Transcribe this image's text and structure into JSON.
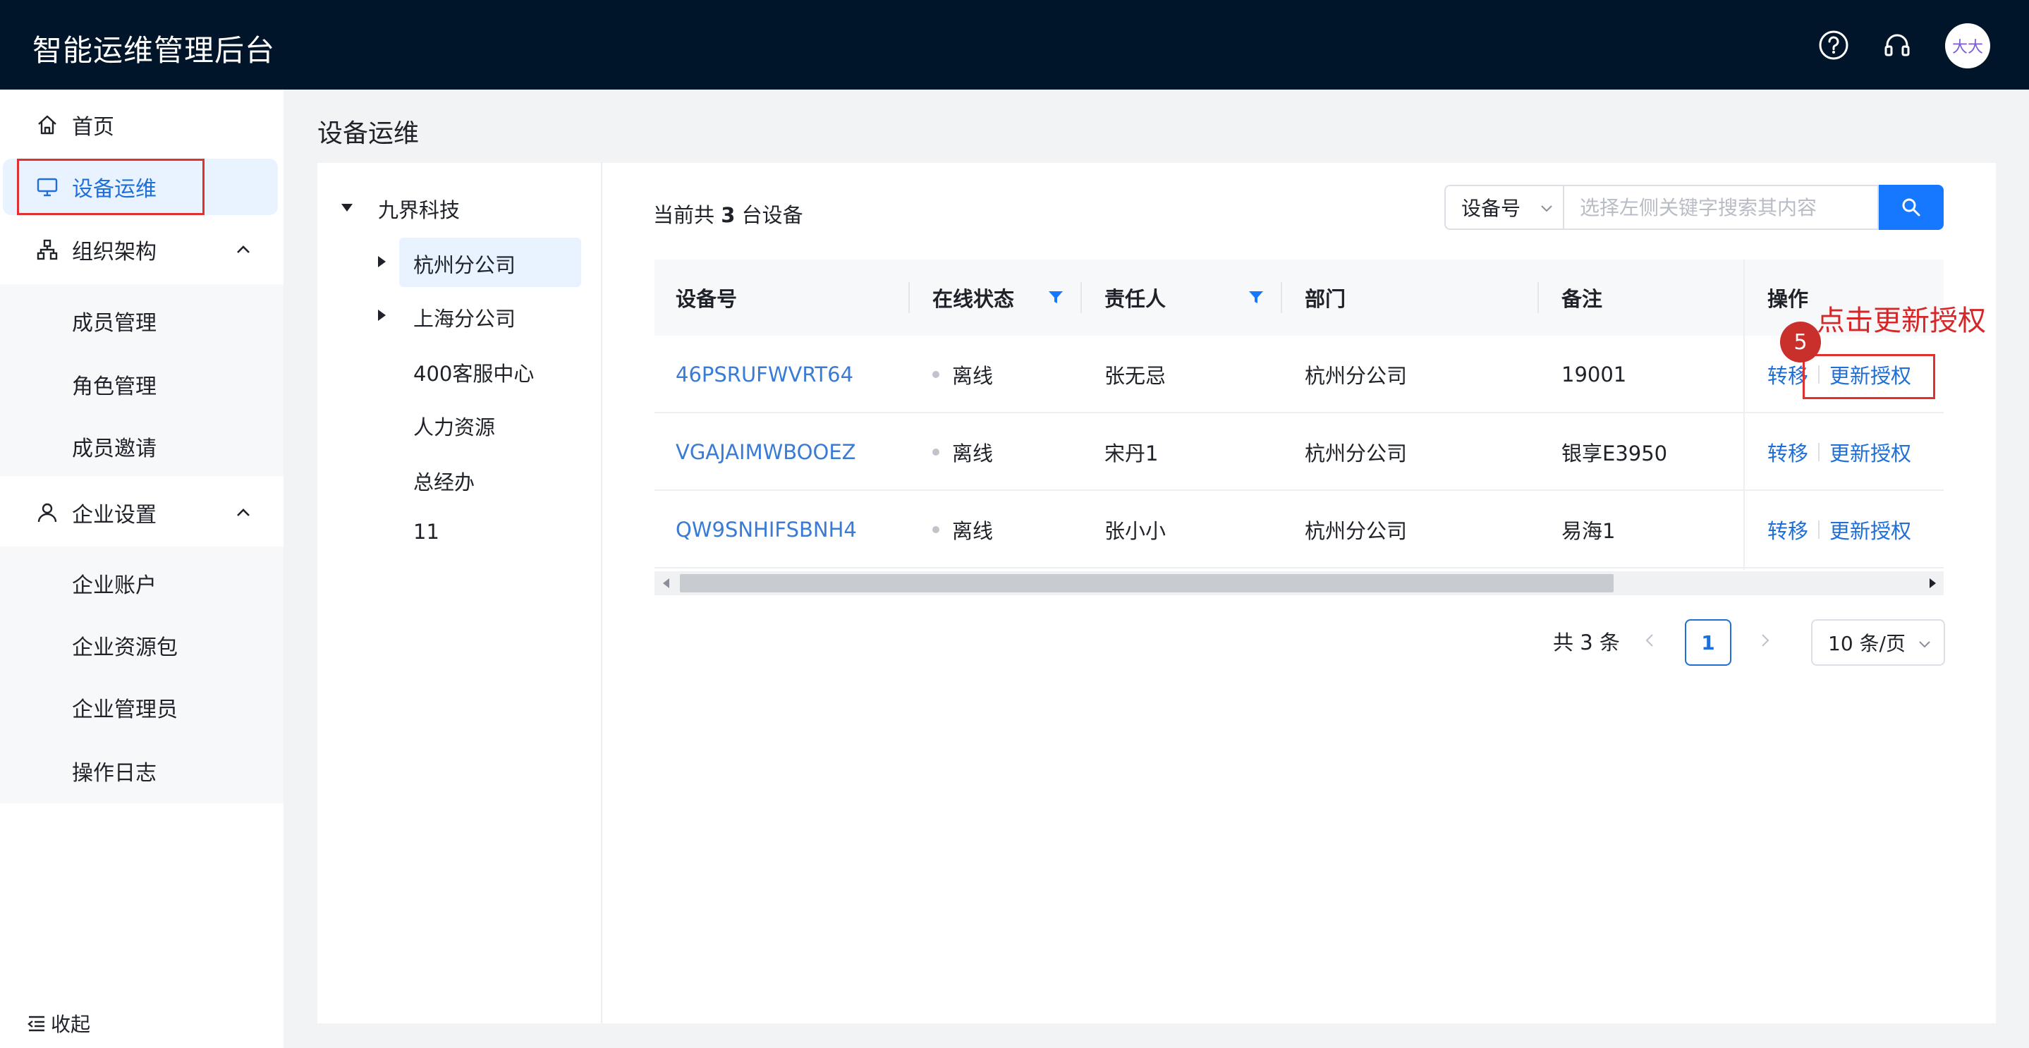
{
  "header": {
    "title": "智能运维管理后台",
    "icons": [
      "help-icon",
      "headset-icon"
    ],
    "avatar_text": "大大"
  },
  "sidebar": {
    "home": "首页",
    "device_ops": "设备运维",
    "org": {
      "label": "组织架构",
      "items": [
        "成员管理",
        "角色管理",
        "成员邀请"
      ]
    },
    "enterprise": {
      "label": "企业设置",
      "items": [
        "企业账户",
        "企业资源包",
        "企业管理员",
        "操作日志"
      ]
    },
    "collapse": "收起"
  },
  "main": {
    "page_title": "设备运维",
    "tree": {
      "root": "九界科技",
      "children": [
        "杭州分公司",
        "上海分公司",
        "400客服中心",
        "人力资源",
        "总经办",
        "11"
      ],
      "selected": "杭州分公司"
    },
    "summary": {
      "prefix": "当前共 ",
      "count": "3",
      "suffix": " 台设备"
    },
    "search": {
      "field": "设备号",
      "placeholder": "选择左侧关键字搜索其内容"
    },
    "table": {
      "columns": [
        "设备号",
        "在线状态",
        "责任人",
        "部门",
        "备注",
        "操作"
      ],
      "rows": [
        {
          "id": "46PSRUFWVRT64",
          "status": "离线",
          "owner": "张无忌",
          "dept": "杭州分公司",
          "note": "19001",
          "op1": "转移",
          "op2": "更新授权"
        },
        {
          "id": "VGAJAIMWBOOEZ",
          "status": "离线",
          "owner": "宋丹1",
          "dept": "杭州分公司",
          "note": "银享E3950",
          "op1": "转移",
          "op2": "更新授权"
        },
        {
          "id": "QW9SNHIFSBNH4",
          "status": "离线",
          "owner": "张小小",
          "dept": "杭州分公司",
          "note": "易海1",
          "op1": "转移",
          "op2": "更新授权"
        }
      ]
    },
    "pagination": {
      "total": "共 3 条",
      "current_page": "1",
      "page_size": "10 条/页"
    },
    "annotation": {
      "step": "5",
      "text": "点击更新授权"
    }
  },
  "colors": {
    "header_bg": "#001529",
    "accent": "#1677ff",
    "annotation": "#d62728"
  }
}
